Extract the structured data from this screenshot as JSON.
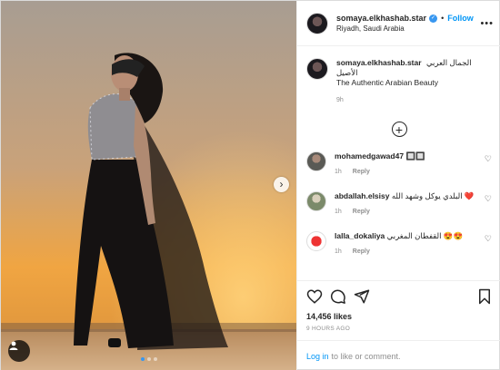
{
  "post": {
    "username": "somaya.elkhashab.star",
    "follow_label": "Follow",
    "bullet": "•",
    "location": "Riyadh, Saudi Arabia",
    "more_icon": "more-dots-icon",
    "caption_lines": [
      "الجمال العربي",
      "الأصيل",
      "The Authentic Arabian Beauty"
    ],
    "caption_time": "9h"
  },
  "comments": [
    {
      "username": "mohamedgawad47",
      "text": "🔲🔲",
      "time": "1h",
      "reply": "Reply"
    },
    {
      "username": "abdallah.elsisy",
      "text": "البلدي يوكل وشهد الله ❤️",
      "time": "1h",
      "reply": "Reply"
    },
    {
      "username": "lalla_dokaliya",
      "text": "القفطان المغربي 😍😍",
      "time": "1h",
      "reply": "Reply"
    }
  ],
  "stats": {
    "likes": "14,456 likes",
    "ago": "9 HOURS AGO"
  },
  "login": {
    "link": "Log in",
    "rest": "to like or comment."
  },
  "carousel": {
    "count": 3,
    "active": 1
  },
  "colors": {
    "accent": "#0095f6",
    "verified": "#3897f0",
    "sky_top": "#b9aa98",
    "sky_glow": "#f5a640"
  }
}
